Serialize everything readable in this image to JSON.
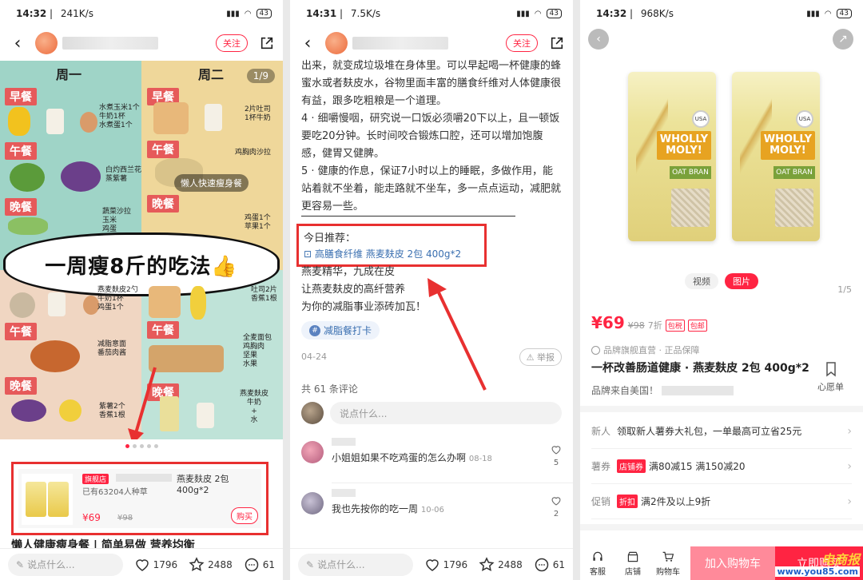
{
  "panel1": {
    "status": {
      "time": "14:32",
      "speed": "241K/s",
      "battery": "43"
    },
    "follow": "关注",
    "image": {
      "page": "1/9",
      "day1": "周一",
      "day2": "周二",
      "breakfast": "早餐",
      "lunch": "午餐",
      "dinner": "晚餐",
      "headline": "一周瘦8斤的吃法👍",
      "pill": "懒人快速瘦身餐",
      "notes": {
        "mon_breakfast": "水煮玉米1个\n牛奶1杯\n水煮蛋1个",
        "tue_breakfast": "2片吐司\n1杯牛奶",
        "mon_lunch": "白灼西兰花\n蒸紫薯",
        "tue_lunch": "鸡胸肉沙拉",
        "mon_dinner": "蔬菜沙拉\n玉米\n鸡蛋",
        "tue_dinner": "鸡蛋1个\n苹果1个",
        "wed_breakfast": "燕麦麸皮2勺\n牛奶1杯\n鸡蛋1个",
        "thu_breakfast": "吐司2片\n香蕉1根",
        "wed_lunch": "减脂意面\n番茄肉酱",
        "thu_lunch": "全麦面包\n鸡胸肉\n坚果\n水果",
        "wed_dinner": "紫薯2个\n香蕉1根",
        "thu_dinner": "燕麦麸皮\n牛奶\n+\n水"
      }
    },
    "product": {
      "badge": "旗舰店",
      "title": "燕麦麸皮 2包 400g*2",
      "bought": "已有63204人种草",
      "price": "¥69",
      "old_price": "¥98",
      "buy": "购买"
    },
    "cutoff_text": "懒人健康瘦身餐 | 简单易做 营养均衡",
    "bottom": {
      "placeholder": "说点什么...",
      "likes": "1796",
      "stars": "2488",
      "comments": "61"
    }
  },
  "panel2": {
    "status": {
      "time": "14:31",
      "speed": "7.5K/s",
      "battery": "43"
    },
    "follow": "关注",
    "paragraphs": [
      "出来，就变成垃圾堆在身体里。可以早起喝一杯健康的蜂蜜水或者麸皮水，谷物里面丰富的膳食纤维对人体健康很有益，跟多吃粗粮是一个道理。",
      "4 · 细嚼慢咽，研究说一口饭必须嚼20下以上，且一顿饭要吃20分钟。长时间咬合锻炼口腔，还可以增加饱腹感，健胃又健脾。",
      "5 · 健康的作息，保证7小时以上的睡眠，多做作用，能站着就不坐着，能走路就不坐车，多一点点运动，减肥就更容易一些。"
    ],
    "rec_label": "今日推荐：",
    "rec_link": "高膳食纤维 燕麦麸皮 2包 400g*2",
    "after_lines": [
      "燕麦精华，九成在皮",
      "让燕麦麸皮的高纤营养",
      "为你的减脂事业添砖加瓦！"
    ],
    "tag": "减脂餐打卡",
    "date": "04-24",
    "report": "举报",
    "comment_count": "共 61 条评论",
    "comment_placeholder": "说点什么...",
    "comments": [
      {
        "text": "小姐姐如果不吃鸡蛋的怎么办啊",
        "date": "08-18",
        "likes": "5"
      },
      {
        "text": "我也先按你的吃一周",
        "date": "10-06",
        "likes": "2"
      }
    ],
    "bottom": {
      "placeholder": "说点什么...",
      "likes": "1796",
      "stars": "2488",
      "comments": "61"
    }
  },
  "panel3": {
    "status": {
      "time": "14:32",
      "speed": "968K/s",
      "battery": "43"
    },
    "bag": {
      "brand": "WHOLLY\nMOLY!",
      "sub": "OAT BRAN",
      "usa": "USA"
    },
    "tabs": [
      "视频",
      "图片"
    ],
    "gallery_count": "1/5",
    "price": "¥69",
    "old_price": "¥98",
    "discount": "7折",
    "tags": [
      "包税",
      "包邮"
    ],
    "guarantee": "品牌旗舰直营 · 正品保障",
    "title": "一杯改善肠道健康 · 燕麦麸皮 2包 400g*2",
    "origin": "品牌来自美国！",
    "wish": "心愿单",
    "rows": [
      {
        "label": "新人",
        "tag": "",
        "text": "领取新人薯券大礼包，一单最高可立省25元"
      },
      {
        "label": "薯券",
        "tag": "店铺券",
        "text": "满80减15 满150减20"
      },
      {
        "label": "促销",
        "tag": "折扣",
        "text": "满2件及以上9折"
      }
    ],
    "bottom": {
      "service": "客服",
      "shop": "店铺",
      "cart": "购物车",
      "add_cart": "加入购物车",
      "buy_now": "立即购买"
    },
    "watermark": {
      "line1": "电商报",
      "line2": "www.you85.com"
    }
  },
  "colors": {
    "accent": "#ff2442",
    "highlight_box": "#e83030",
    "link": "#3a6fb0"
  }
}
